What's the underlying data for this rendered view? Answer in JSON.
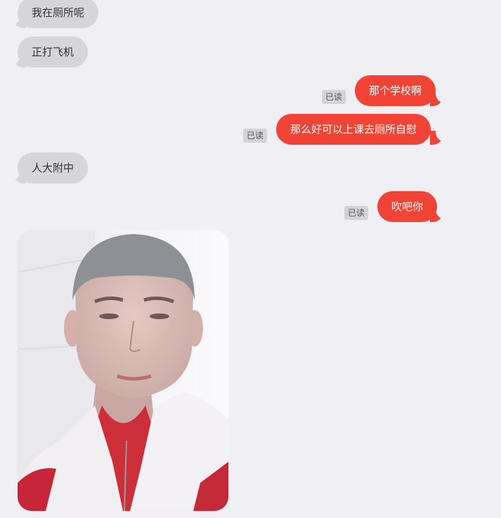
{
  "messages": [
    {
      "side": "in",
      "text": "我在厕所呢"
    },
    {
      "side": "in",
      "text": "正打飞机"
    },
    {
      "side": "out",
      "text": "那个学校啊",
      "status": "已读"
    },
    {
      "side": "out",
      "text": "那么好可以上课去厕所自慰",
      "status": "已读"
    },
    {
      "side": "in",
      "text": "人大附中"
    },
    {
      "side": "out",
      "text": "吹吧你",
      "status": "已读"
    }
  ],
  "photo": {
    "kind": "selfie-photo"
  },
  "colors": {
    "background": "#f0eff4",
    "incoming_bubble": "#d6d6d8",
    "outgoing_bubble": "#f14336",
    "read_badge": "#d4d4d6"
  }
}
